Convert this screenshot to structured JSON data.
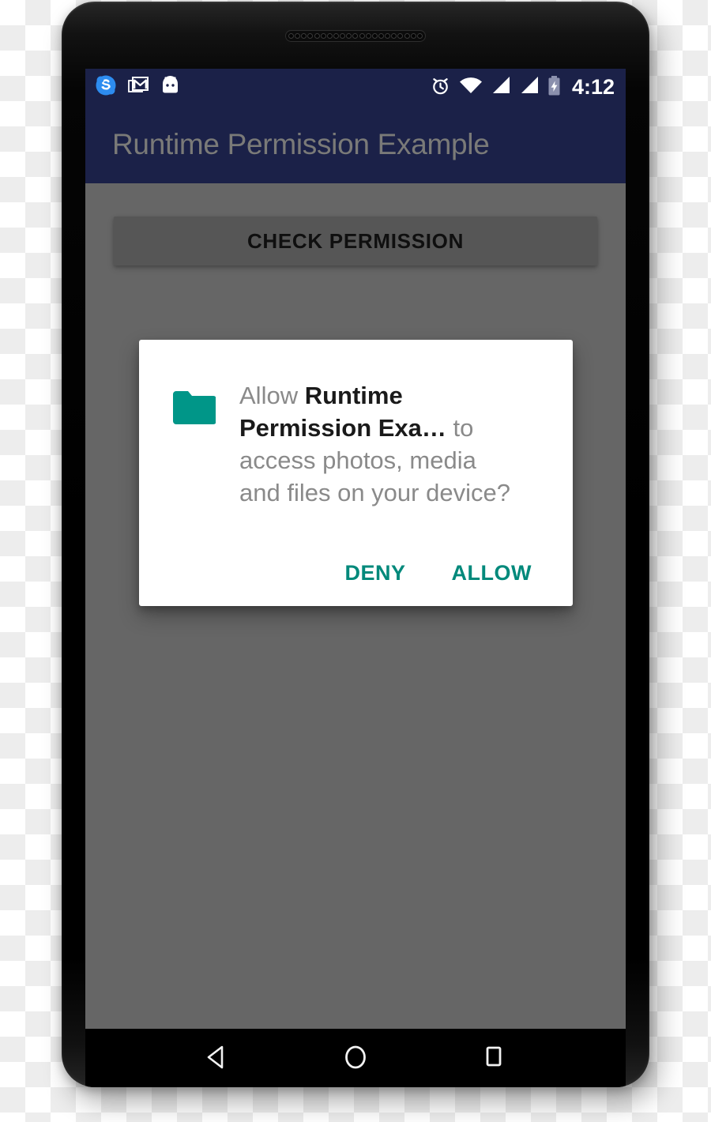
{
  "device": {
    "name": "android-phone-mockup",
    "earpiece_hole_count": 21
  },
  "status_bar": {
    "background_color": "#1b2148",
    "left_icons": [
      {
        "name": "skype-notification-icon",
        "glyph": "S"
      },
      {
        "name": "gmail-notification-icon",
        "glyph": "M"
      },
      {
        "name": "android-system-icon",
        "glyph": "android"
      }
    ],
    "right_icons": [
      {
        "name": "alarm-clock-icon"
      },
      {
        "name": "wifi-icon"
      },
      {
        "name": "signal-sim1-icon"
      },
      {
        "name": "signal-sim2-icon"
      },
      {
        "name": "battery-charging-icon"
      }
    ],
    "clock": "4:12"
  },
  "app_bar": {
    "title": "Runtime Permission Example",
    "background_color": "#1b2148",
    "title_color": "#7a7a78"
  },
  "content": {
    "scrim_color": "#666666",
    "check_permission_button": "CHECK PERMISSION"
  },
  "dialog": {
    "icon": "folder-icon",
    "icon_color": "#009688",
    "message_parts": {
      "prefix": "Allow ",
      "app_name": "Runtime Permission Exa…",
      "suffix": " to access photos, media and files on your device?"
    },
    "deny_label": "DENY",
    "allow_label": "ALLOW",
    "action_color": "#00897b",
    "background_color": "#ffffff"
  },
  "nav_bar": {
    "background_color": "#000000",
    "buttons": [
      {
        "name": "nav-back-button",
        "icon": "back-triangle-icon"
      },
      {
        "name": "nav-home-button",
        "icon": "home-circle-icon"
      },
      {
        "name": "nav-recents-button",
        "icon": "recents-square-icon"
      }
    ]
  }
}
